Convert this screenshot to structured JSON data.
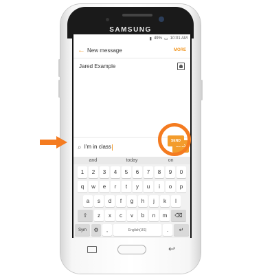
{
  "device": {
    "brand": "SAMSUNG"
  },
  "status_bar": {
    "battery": "49%",
    "time": "10:01 AM"
  },
  "app_bar": {
    "back_icon": "arrow-left",
    "title": "New message",
    "more_label": "MORE"
  },
  "recipient": {
    "name": "Jared Example",
    "icon": "contact-card"
  },
  "composer": {
    "attach_icon": "paperclip",
    "text": "I'm in class",
    "send_label": "SEND"
  },
  "suggestions": [
    "and",
    "today",
    "on"
  ],
  "keyboard": {
    "row_numbers": [
      "1",
      "2",
      "3",
      "4",
      "5",
      "6",
      "7",
      "8",
      "9",
      "0"
    ],
    "row1": [
      "q",
      "w",
      "e",
      "r",
      "t",
      "y",
      "u",
      "i",
      "o",
      "p"
    ],
    "row2": [
      "a",
      "s",
      "d",
      "f",
      "g",
      "h",
      "j",
      "k",
      "l"
    ],
    "row3": [
      "z",
      "x",
      "c",
      "v",
      "b",
      "n",
      "m"
    ],
    "shift_icon": "shift-arrow",
    "backspace_icon": "backspace",
    "sym_label": "Sym",
    "settings_icon": "gear",
    "space_label": "English(US)",
    "period_label": ".",
    "enter_icon": "return"
  },
  "colors": {
    "accent": "#f39c2c",
    "annotation": "#f47b20"
  }
}
